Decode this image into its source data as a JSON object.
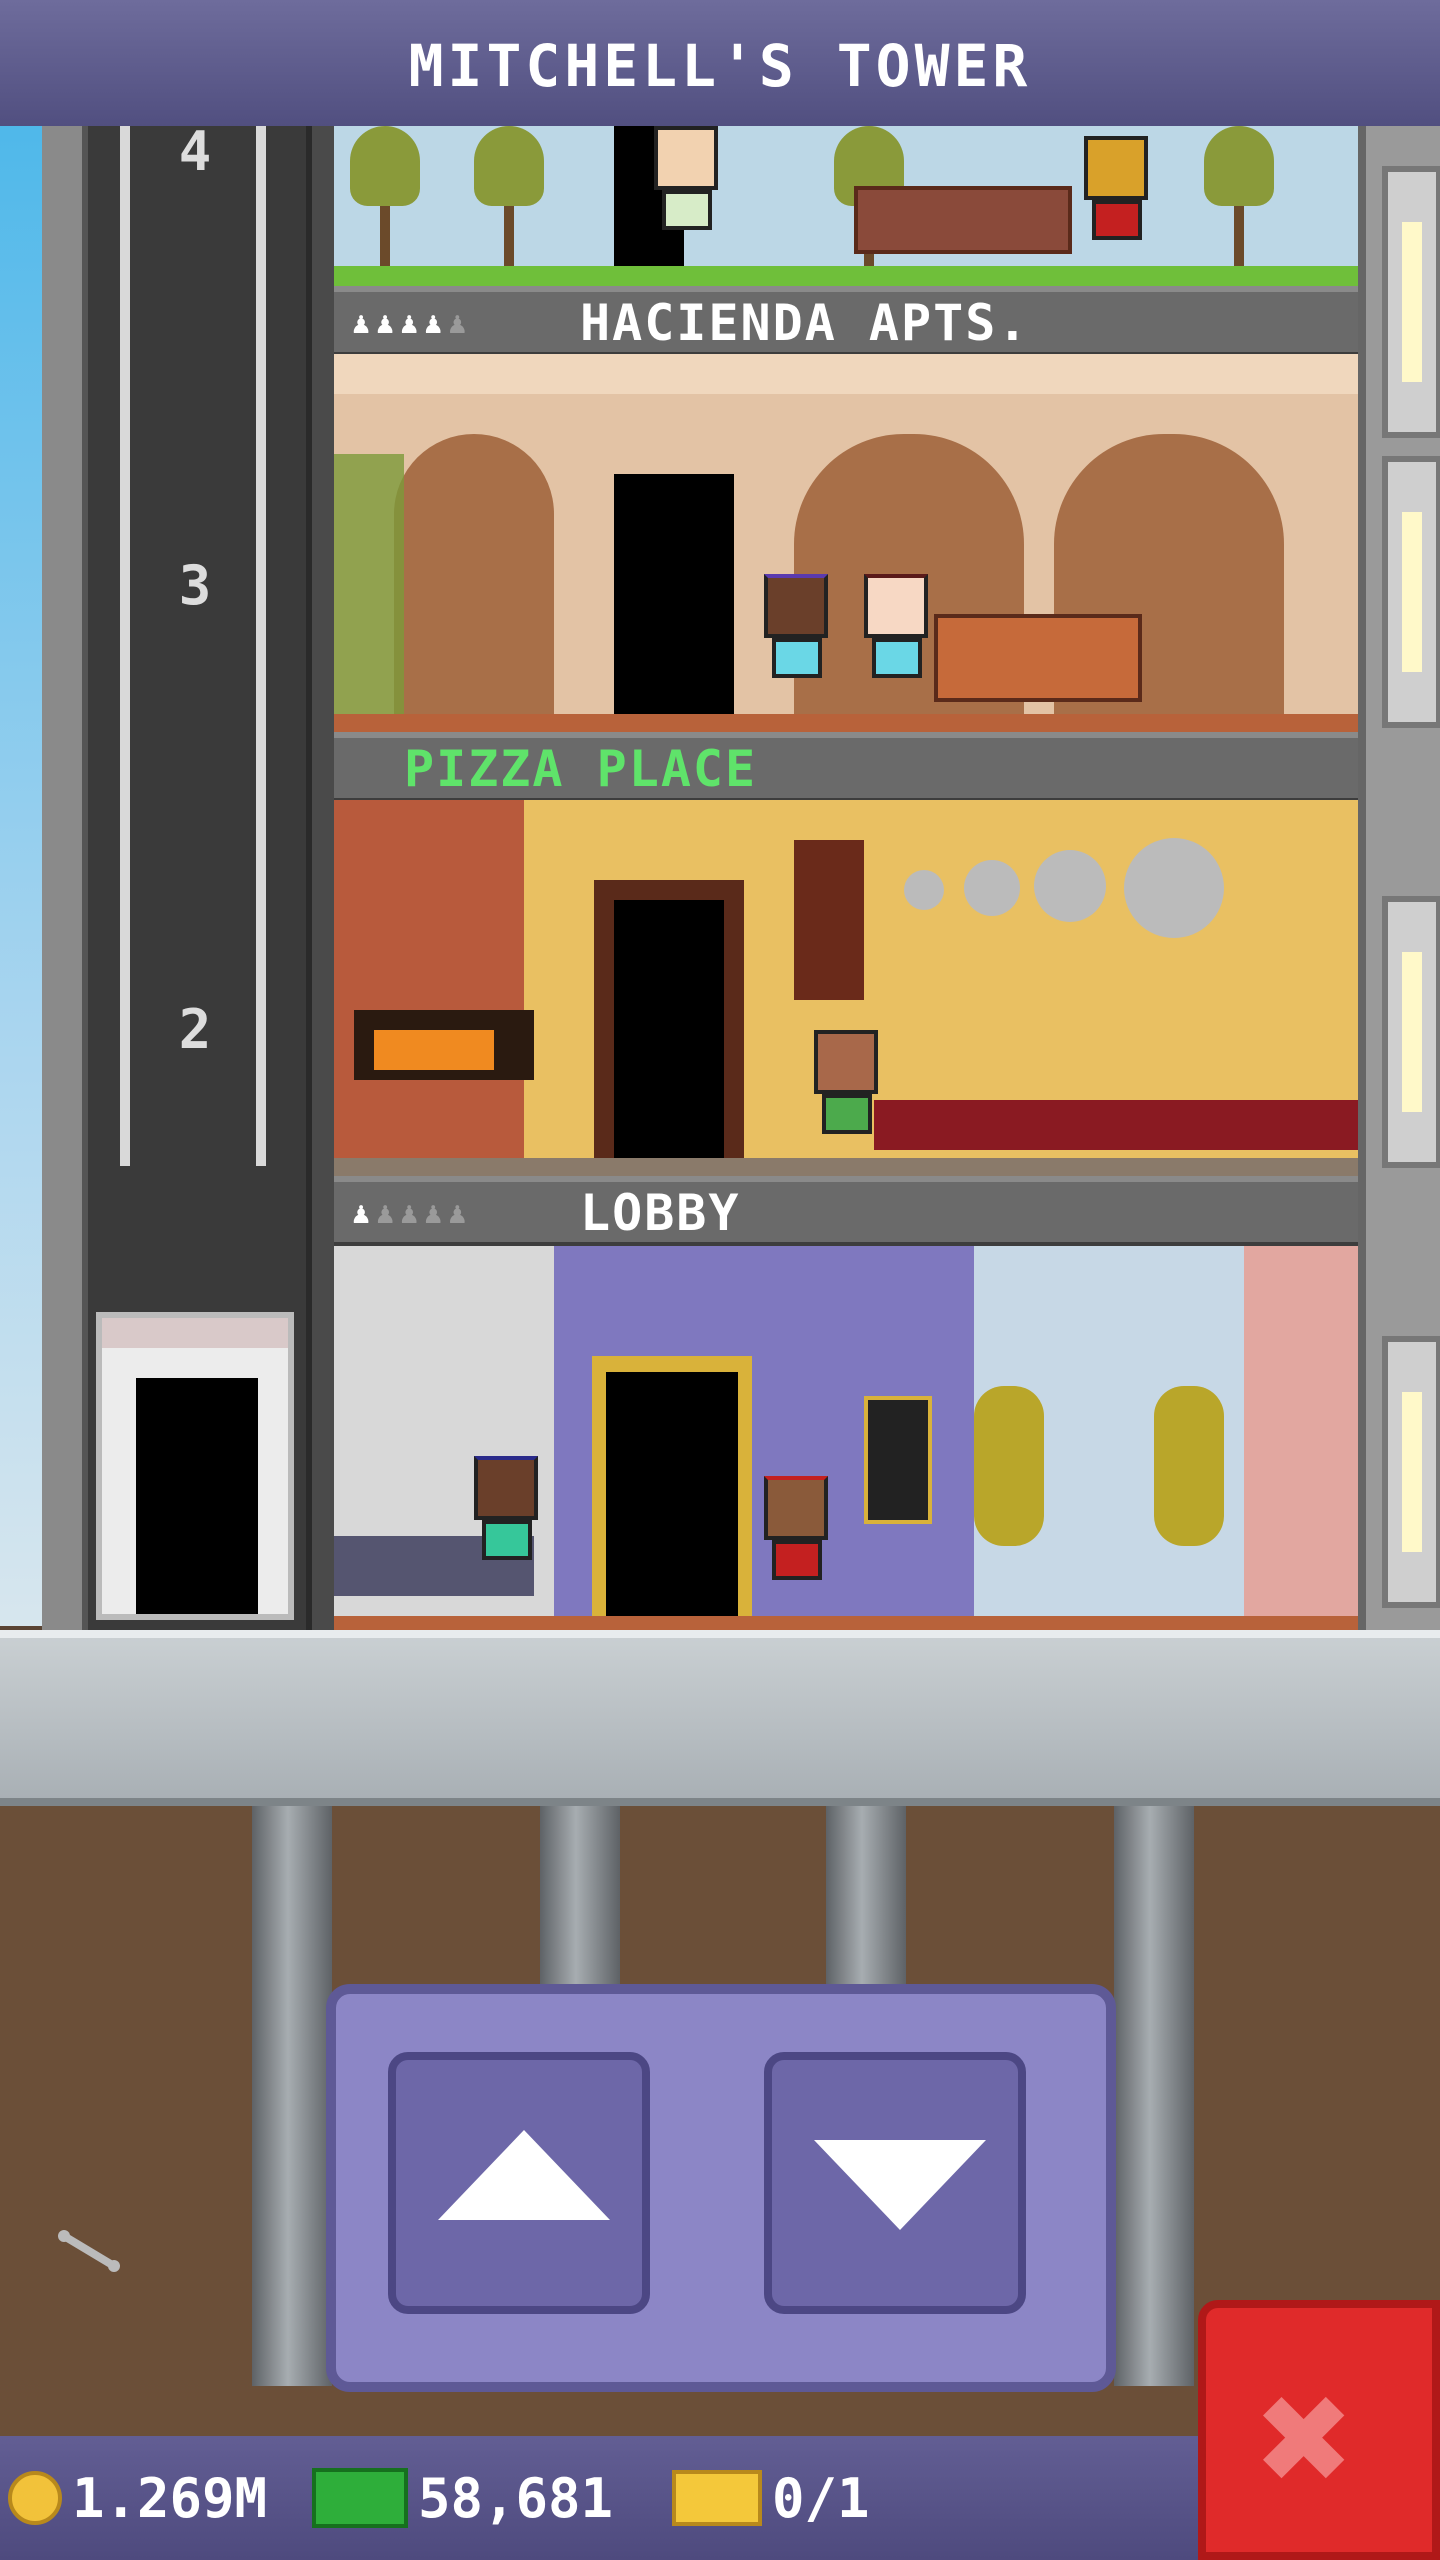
{
  "title": "MITCHELL'S TOWER",
  "shaft": {
    "floor_numbers": [
      "4",
      "3",
      "2"
    ]
  },
  "floors": [
    {
      "name": "HACIENDA APTS.",
      "stars_filled": 4,
      "stars_total": 5,
      "color": "#ffffff"
    },
    {
      "name": "PIZZA PLACE",
      "color": "#5fe36a"
    },
    {
      "name": "LOBBY",
      "stars_filled": 1,
      "stars_total": 5,
      "color": "#ffffff"
    }
  ],
  "controls": {
    "up_icon": "arrow-up",
    "down_icon": "arrow-down",
    "close_icon": "close-x"
  },
  "status": {
    "coins": "1.269M",
    "bux": "58,681",
    "tickets": "0/1"
  },
  "colors": {
    "title_bar": "#5f5d8e",
    "control_panel": "#8c86c6",
    "close_button": "#e02a2a"
  }
}
